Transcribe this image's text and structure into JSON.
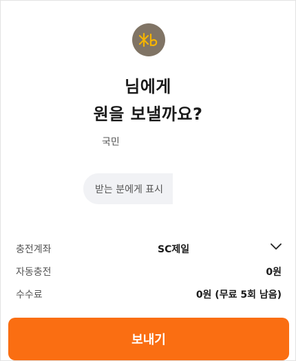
{
  "bank_logo": {
    "icon": "kb-logo-icon",
    "text": "KB",
    "bg_color": "#807465",
    "mark_color": "#f5b400"
  },
  "headline": {
    "line1": "님에게",
    "line2": "원을 보낼까요?"
  },
  "recipient": {
    "bank": "국민"
  },
  "memo": {
    "placeholder": "받는 분에게 표시"
  },
  "details": {
    "account": {
      "label": "충전계좌",
      "value": "SC제일",
      "icon": "chevron-down-icon"
    },
    "auto_charge": {
      "label": "자동충전",
      "value": "0원"
    },
    "fee": {
      "label": "수수료",
      "value": "0원 (무료 5회 남음)"
    }
  },
  "send_button": {
    "label": "보내기",
    "color": "#fa6e12"
  }
}
